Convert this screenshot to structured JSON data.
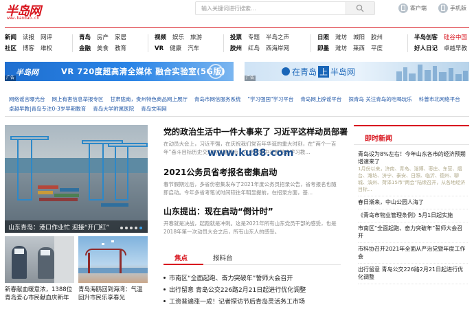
{
  "header": {
    "logo_text": "半岛网",
    "logo_url": "www.bandao.cn",
    "search_placeholder": "输入关键词进行搜索...",
    "client_label": "客户端",
    "mobile_label": "手机版"
  },
  "nav": {
    "groups": [
      {
        "r1": [
          "新闻",
          "读报",
          "网评"
        ],
        "r2": [
          "社区",
          "博客",
          "维权"
        ],
        "bold1": [
          0
        ],
        "bold2": [
          0
        ]
      },
      {
        "r1": [
          "青岛",
          "房产",
          "家居"
        ],
        "r2": [
          "金融",
          "美食",
          "教育"
        ],
        "bold1": [
          0
        ],
        "bold2": [
          0
        ]
      },
      {
        "r1": [
          "视频",
          "娱乐",
          "旅游"
        ],
        "r2": [
          "VR",
          "健康",
          "汽车"
        ],
        "bold1": [
          0
        ],
        "bold2": [
          0
        ]
      },
      {
        "r1": [
          "投票",
          "专题",
          "半岛之声"
        ],
        "r2": [
          "胶州",
          "红岛",
          "西海岸网"
        ],
        "bold1": [
          0
        ],
        "bold2": [
          0
        ]
      },
      {
        "r1": [
          "日照",
          "潍坊",
          "城阳",
          "胶州"
        ],
        "r2": [
          "即墨",
          "潍坊",
          "莱西",
          "平度"
        ],
        "bold1": [
          0
        ],
        "bold2": [
          0
        ]
      },
      {
        "r1": [
          "半岛创客",
          "硅谷中国"
        ],
        "r2": [
          "好人日记",
          "卓越早教"
        ],
        "bold1": [
          0
        ],
        "bold2": [
          0
        ],
        "red1": [
          1
        ]
      }
    ]
  },
  "banners": {
    "left_ad": "广告",
    "left_logo": "半岛网",
    "left_text": "VR 720度超高清全媒体 融合实验室(5G版)",
    "right_ad": "广告",
    "right_pre": "在青岛",
    "right_box": "上",
    "right_post": "半岛网"
  },
  "links": {
    "row1": [
      "网络谣言曝光台",
      "网上有害信息举报专区",
      "甘肃陇南，贵州特色商品网上展厅",
      "青岛市网信服务系统",
      "\"学习强国\"学习平台",
      "青岛网上辟谣平台",
      "探青岛 关注青岛的吃喝玩乐",
      "科普市北网络平台"
    ],
    "row2": [
      "卓越早教|青岛专注0-3岁早期教育",
      "青岛大学附属医院",
      "青岛文明网"
    ]
  },
  "slideshow": {
    "caption": "山东青岛：港口作业忙 迎接“开门红”"
  },
  "thumbs": [
    {
      "caption": "新春献血暖意浓，1388位青岛爱心市民献血庆新年"
    },
    {
      "caption": "青岛海鸥回到海湾：气温回升市民乐享春光"
    }
  ],
  "news": [
    {
      "title": "党的政治生活中一件大事来了 习近平这样动员部署",
      "summary": "在动员大会上，习近平强，在庆祝我们党百年华诞的重大时刻，在“两个一百年”奋斗目标历史交汇的关键节点，在全党集中开展党史学习教..."
    },
    {
      "title": "2021公务员省考报名密集启动",
      "summary": "春节假期过后，多省份密集发布了2021年度公务员招录公告，省考报名也随即启动。今年多省考笔试时间较往年明显提前，在招录方面，基..."
    },
    {
      "title": "山东提出：现在启动“倒计时”",
      "summary": "开春就是决战，起跑就是冲刺。这是2021年所有山东党员干部的感受，也是2018年第一次动员大会之后，所有山东人的感受。"
    }
  ],
  "watermark": "www.ku88.com",
  "tabs": [
    "焦点",
    "报料台"
  ],
  "feed": [
    {
      "text": "市南区“全面起跑、奋力突破年”誓师大会召开",
      "bold": true
    },
    {
      "text": "出行留意 青岛公交226路2月21日起进行优化调整",
      "bold": false
    },
    {
      "text": "工资普遍涨一成！记者探访节后青岛灵活务工市场",
      "bold": false
    }
  ],
  "side": {
    "title": "即时新闻",
    "items": [
      {
        "title": "青岛设为8%左右！今年山东各市的经济预期增速来了",
        "sub": "1月份以来，济南、青岛、淄博、枣庄、东营、烟台、潍坊、济宁、泰安、日照、临沂、德州、聊城、滨州、菏泽15市“两会”陆续召开，从各地经济目标..."
      },
      {
        "title": "春日渐来，中山公园人海了",
        "sub": ""
      },
      {
        "title": "《青岛市物业管理条例》5月1日起实施",
        "sub": ""
      },
      {
        "title": "市南区“全面起跑、奋力突破年”誓师大会召开",
        "sub": ""
      },
      {
        "title": "市科协召开2021年全面从严治党暨年度工作会",
        "sub": ""
      },
      {
        "title": "出行留意 青岛公交226路2月21日起进行优化调整",
        "sub": ""
      }
    ]
  },
  "colors": {
    "brand_red": "#d8161f",
    "link_blue": "#245aa8"
  }
}
